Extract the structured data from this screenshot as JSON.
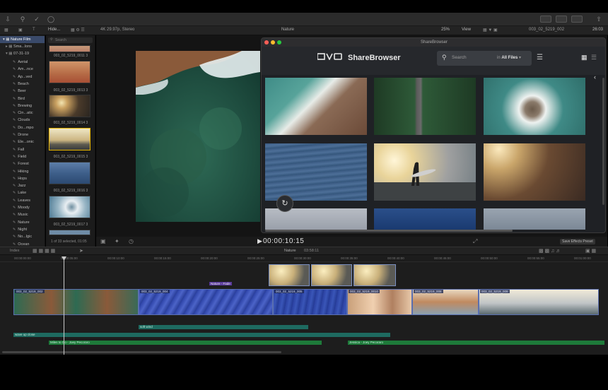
{
  "toolbar": {
    "time_display": "26:03"
  },
  "bar2": {
    "hide_label": "Hide...",
    "format": "4K 29.97p, Stereo",
    "viewer_title": "Nature",
    "zoom": "25%",
    "view_label": "View",
    "clip_name": "003_02_5219_002"
  },
  "sidebar": {
    "library": "Nature Film",
    "smart": "Sma...lons",
    "event": "07-31-19",
    "keywords": [
      "Aerial",
      "Am...nce",
      "Ap...ved",
      "Beach",
      "Beer",
      "Bird",
      "Brewing",
      "Cin...atic",
      "Clouds",
      "Do...mpo",
      "Drone",
      "Ele...onic",
      "Fall",
      "Field",
      "Forest",
      "Hiking",
      "Hops",
      "Jazz",
      "Lake",
      "Leaves",
      "Moody",
      "Music",
      "Nature",
      "Night",
      "No...lgic",
      "Ocean"
    ]
  },
  "browser": {
    "search_placeholder": "Search",
    "clips": [
      "003_02_5219_0011 3",
      "003_02_5219_0013 3",
      "003_02_5219_0014 3",
      "003_02_5219_0015 3",
      "003_02_5219_0016 3",
      "003_02_5219_0017 3"
    ],
    "selection_status": "1 of 33 selected, 01:05"
  },
  "sharebrowser": {
    "window_title": "ShareBrowser",
    "logo": "EVO",
    "brand": "ShareBrowser",
    "search_placeholder": "Search",
    "search_in_prefix": "in",
    "search_scope": "All Files"
  },
  "viewer_controls": {
    "timecode": "00:00:10:15",
    "save_effects": "Save Effects Preset"
  },
  "timeline": {
    "index_label": "Index",
    "project": "Nature",
    "duration": "03:58:11",
    "ruler": [
      "00:00:00:00",
      "00:00:05:00",
      "00:00:10:00",
      "00:00:15:00",
      "00:00:20:00",
      "00:00:25:00",
      "00:00:30:00",
      "00:00:35:00",
      "00:00:40:00",
      "00:00:45:00",
      "00:00:50:00",
      "00:00:55:00",
      "00:01:00:00",
      "00:01:05:00"
    ],
    "transition": "Nature - Fade",
    "clips": [
      "003_02_5219_002",
      "003_02_5219_004",
      "003_02_5219_005",
      "003_02_5219_0010",
      "003_02_5219_008",
      "003_02_5219_009"
    ],
    "audio": [
      "soft wind",
      "wave up close",
      "Miles to Go - Joey Pecoraro",
      "Jessica - Joey Pecoraro"
    ]
  }
}
